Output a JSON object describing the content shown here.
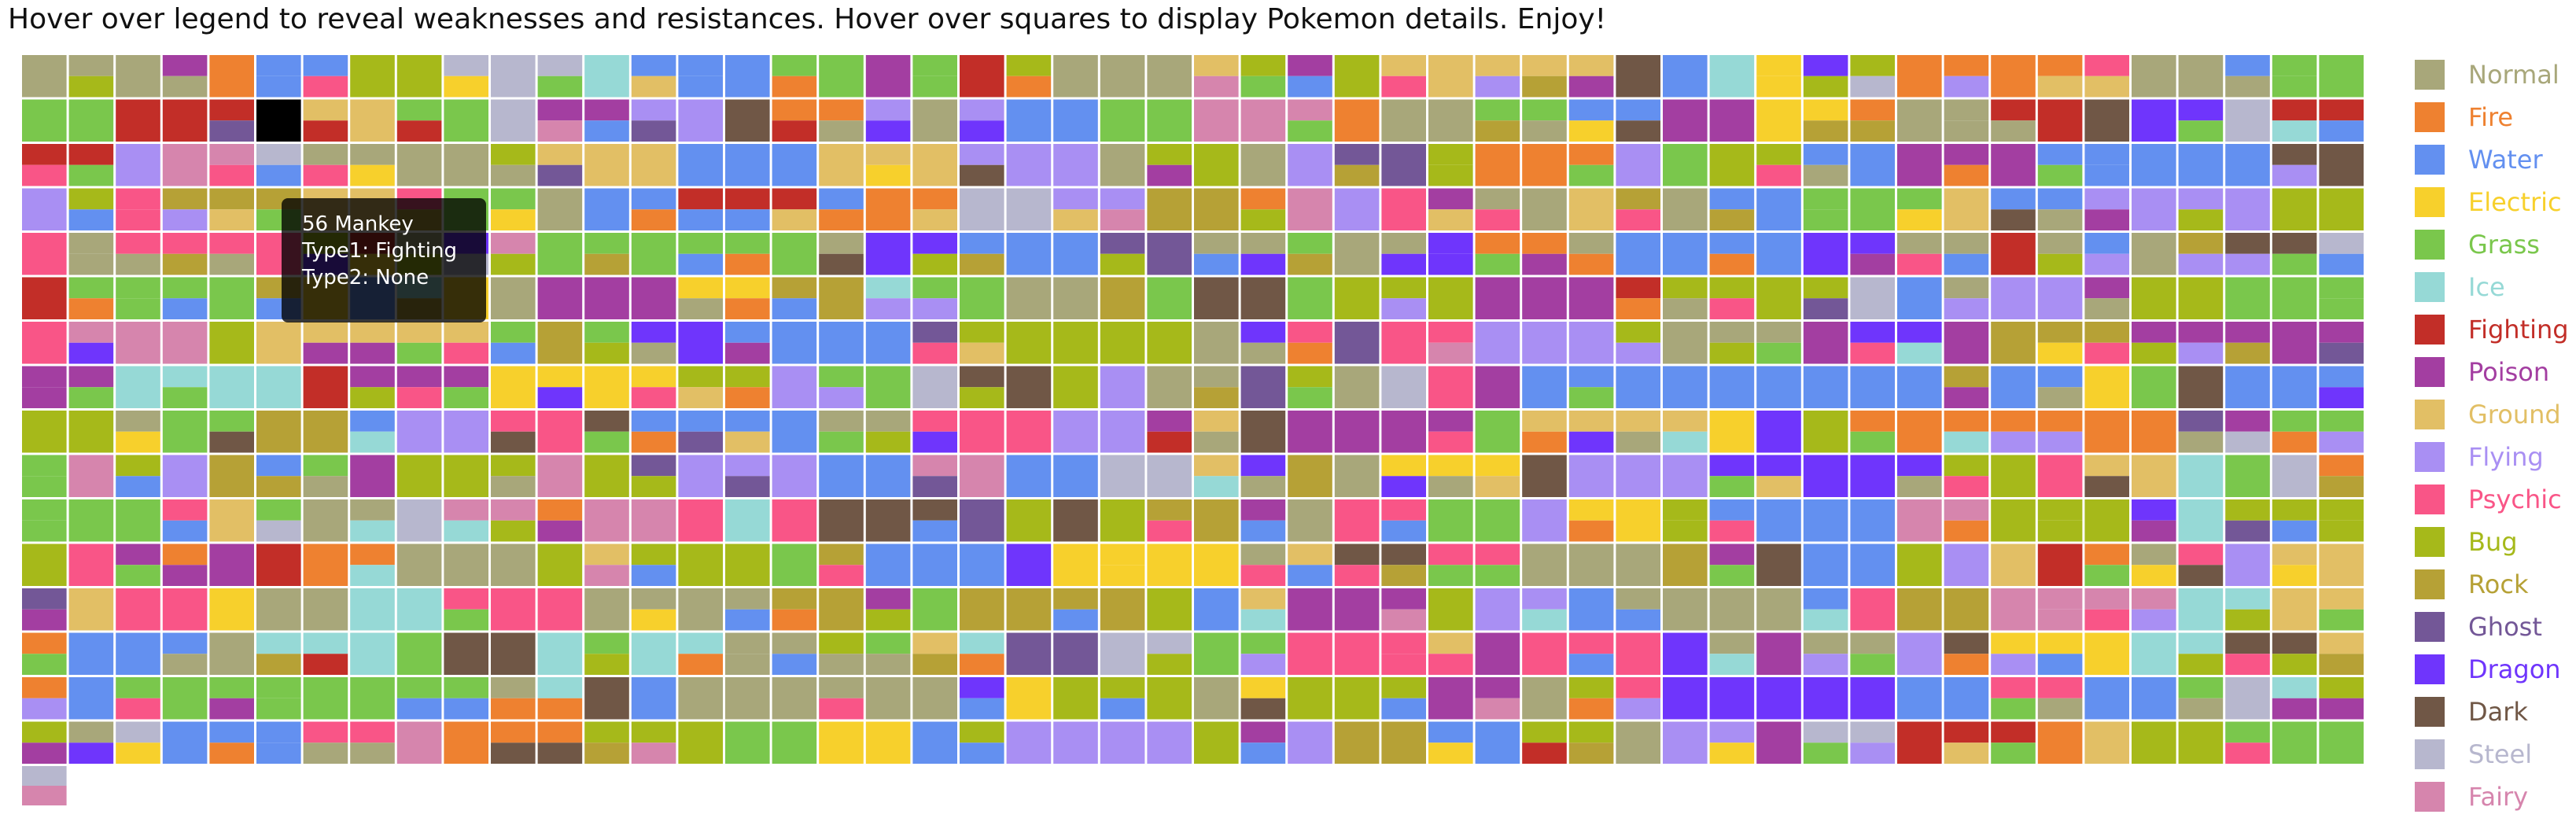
{
  "header": {
    "instructions": "Hover over legend to reveal weaknesses and resistances. Hover over squares to display Pokemon details. Enjoy!"
  },
  "tooltip": {
    "line1": "56 Mankey",
    "line2": "Type1: Fighting",
    "line3": "Type2: None"
  },
  "types": [
    {
      "name": "Normal",
      "color": "#A8A77A"
    },
    {
      "name": "Fire",
      "color": "#EE8130"
    },
    {
      "name": "Water",
      "color": "#6390F0"
    },
    {
      "name": "Electric",
      "color": "#F7D02C"
    },
    {
      "name": "Grass",
      "color": "#7AC74C"
    },
    {
      "name": "Ice",
      "color": "#96D9D6"
    },
    {
      "name": "Fighting",
      "color": "#C22E28"
    },
    {
      "name": "Poison",
      "color": "#A33EA1"
    },
    {
      "name": "Ground",
      "color": "#E2BF65"
    },
    {
      "name": "Flying",
      "color": "#A98FF3"
    },
    {
      "name": "Psychic",
      "color": "#F95587"
    },
    {
      "name": "Bug",
      "color": "#A6B91A"
    },
    {
      "name": "Rock",
      "color": "#B6A136"
    },
    {
      "name": "Ghost",
      "color": "#735797"
    },
    {
      "name": "Dragon",
      "color": "#6F35FC"
    },
    {
      "name": "Dark",
      "color": "#705746"
    },
    {
      "name": "Steel",
      "color": "#B7B7CE"
    },
    {
      "name": "Fairy",
      "color": "#D685AD"
    }
  ],
  "highlight_color": "#000000"
}
